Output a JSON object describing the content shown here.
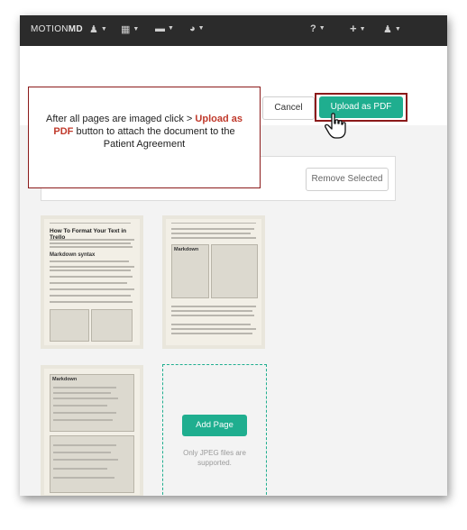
{
  "navbar": {
    "logo_light": "MOTION",
    "logo_bold": "MD",
    "items": [
      {
        "icon": "user-medical-icon",
        "glyph": "♟"
      },
      {
        "icon": "grid-icon",
        "glyph": "▦"
      },
      {
        "icon": "card-icon",
        "glyph": "▬"
      },
      {
        "icon": "globe-icon",
        "glyph": "◕"
      },
      {
        "icon": "help-icon",
        "glyph": "?"
      },
      {
        "icon": "plus-icon",
        "glyph": "+"
      },
      {
        "icon": "user-icon",
        "glyph": "♟"
      }
    ]
  },
  "toolbar": {
    "cancel_label": "Cancel",
    "upload_label": "Upload as PDF",
    "remove_label": "Remove Selected"
  },
  "callout": {
    "text_before": "After all pages are imaged click > ",
    "highlight": "Upload as PDF",
    "text_after": " button to attach the document to the Patient Agreement"
  },
  "pages": [
    {
      "title": "How To Format Your Text in Trello",
      "subtitle": "Markdown syntax"
    },
    {
      "title": "",
      "subtitle": "Markdown"
    },
    {
      "title": "",
      "subtitle": "Markdown"
    }
  ],
  "add_page": {
    "label": "Add Page",
    "note": "Only JPEG files are supported."
  },
  "colors": {
    "accent": "#1fae8f",
    "callout_border": "#8b1a1a",
    "highlight": "#c0392b",
    "navbar": "#2b2b2b"
  }
}
